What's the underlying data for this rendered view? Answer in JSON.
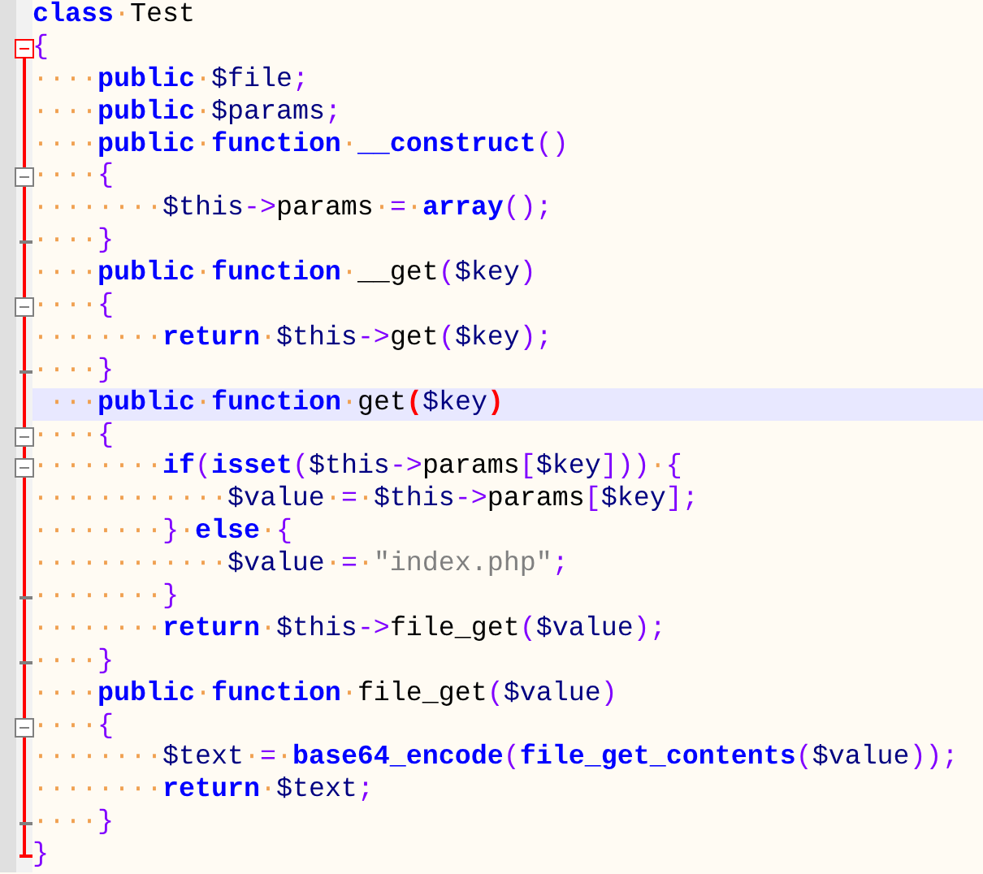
{
  "editor": {
    "lines": [
      {
        "kind": "code",
        "fold_highlighted": false,
        "current": false,
        "tokens": [
          {
            "kind": "keyword",
            "text": "class"
          },
          {
            "kind": "space",
            "text": "·"
          },
          {
            "kind": "plain",
            "text": "Test"
          }
        ]
      },
      {
        "kind": "fold-start",
        "fold_highlighted": true,
        "current": false,
        "tokens": [
          {
            "kind": "operator",
            "text": "{"
          }
        ]
      },
      {
        "kind": "code",
        "fold_highlighted": true,
        "current": false,
        "tokens": [
          {
            "kind": "space",
            "text": "····"
          },
          {
            "kind": "keyword",
            "text": "public"
          },
          {
            "kind": "space",
            "text": "·"
          },
          {
            "kind": "variable",
            "text": "$file"
          },
          {
            "kind": "operator",
            "text": ";"
          }
        ]
      },
      {
        "kind": "code",
        "fold_highlighted": true,
        "current": false,
        "tokens": [
          {
            "kind": "space",
            "text": "····"
          },
          {
            "kind": "keyword",
            "text": "public"
          },
          {
            "kind": "space",
            "text": "·"
          },
          {
            "kind": "variable",
            "text": "$params"
          },
          {
            "kind": "operator",
            "text": ";"
          }
        ]
      },
      {
        "kind": "code",
        "fold_highlighted": true,
        "current": false,
        "tokens": [
          {
            "kind": "space",
            "text": "····"
          },
          {
            "kind": "keyword",
            "text": "public"
          },
          {
            "kind": "space",
            "text": "·"
          },
          {
            "kind": "keyword",
            "text": "function"
          },
          {
            "kind": "space",
            "text": "·"
          },
          {
            "kind": "keyword",
            "text": "__construct"
          },
          {
            "kind": "operator",
            "text": "()"
          }
        ]
      },
      {
        "kind": "fold-start",
        "fold_highlighted": true,
        "current": false,
        "tokens": [
          {
            "kind": "space",
            "text": "····"
          },
          {
            "kind": "operator",
            "text": "{"
          }
        ]
      },
      {
        "kind": "code",
        "fold_highlighted": true,
        "current": false,
        "tokens": [
          {
            "kind": "space",
            "text": "········"
          },
          {
            "kind": "variable",
            "text": "$this"
          },
          {
            "kind": "operator",
            "text": "->"
          },
          {
            "kind": "plain",
            "text": "params"
          },
          {
            "kind": "space",
            "text": "·"
          },
          {
            "kind": "operator",
            "text": "="
          },
          {
            "kind": "space",
            "text": "·"
          },
          {
            "kind": "keyword",
            "text": "array"
          },
          {
            "kind": "operator",
            "text": "();"
          }
        ]
      },
      {
        "kind": "fold-end",
        "fold_highlighted": true,
        "current": false,
        "tokens": [
          {
            "kind": "space",
            "text": "····"
          },
          {
            "kind": "operator",
            "text": "}"
          }
        ]
      },
      {
        "kind": "code",
        "fold_highlighted": true,
        "current": false,
        "tokens": [
          {
            "kind": "space",
            "text": "····"
          },
          {
            "kind": "keyword",
            "text": "public"
          },
          {
            "kind": "space",
            "text": "·"
          },
          {
            "kind": "keyword",
            "text": "function"
          },
          {
            "kind": "space",
            "text": "·"
          },
          {
            "kind": "plain",
            "text": "__get"
          },
          {
            "kind": "operator",
            "text": "("
          },
          {
            "kind": "variable",
            "text": "$key"
          },
          {
            "kind": "operator",
            "text": ")"
          }
        ]
      },
      {
        "kind": "fold-start",
        "fold_highlighted": true,
        "current": false,
        "tokens": [
          {
            "kind": "space",
            "text": "····"
          },
          {
            "kind": "operator",
            "text": "{"
          }
        ]
      },
      {
        "kind": "code",
        "fold_highlighted": true,
        "current": false,
        "tokens": [
          {
            "kind": "space",
            "text": "········"
          },
          {
            "kind": "keyword",
            "text": "return"
          },
          {
            "kind": "space",
            "text": "·"
          },
          {
            "kind": "variable",
            "text": "$this"
          },
          {
            "kind": "operator",
            "text": "->"
          },
          {
            "kind": "plain",
            "text": "get"
          },
          {
            "kind": "operator",
            "text": "("
          },
          {
            "kind": "variable",
            "text": "$key"
          },
          {
            "kind": "operator",
            "text": ");"
          }
        ]
      },
      {
        "kind": "fold-end",
        "fold_highlighted": true,
        "current": false,
        "tokens": [
          {
            "kind": "space",
            "text": "····"
          },
          {
            "kind": "operator",
            "text": "}"
          }
        ]
      },
      {
        "kind": "code",
        "fold_highlighted": true,
        "current": true,
        "tokens": [
          {
            "kind": "space",
            "text": "···"
          },
          {
            "kind": "keyword",
            "text": "public"
          },
          {
            "kind": "space",
            "text": "·"
          },
          {
            "kind": "keyword",
            "text": "function"
          },
          {
            "kind": "space",
            "text": "·"
          },
          {
            "kind": "plain",
            "text": "get"
          },
          {
            "kind": "match",
            "text": "("
          },
          {
            "kind": "variable",
            "text": "$key"
          },
          {
            "kind": "match",
            "text": ")"
          }
        ]
      },
      {
        "kind": "fold-start",
        "fold_highlighted": true,
        "current": false,
        "tokens": [
          {
            "kind": "space",
            "text": "····"
          },
          {
            "kind": "operator",
            "text": "{"
          }
        ]
      },
      {
        "kind": "fold-start",
        "fold_highlighted": true,
        "current": false,
        "tokens": [
          {
            "kind": "space",
            "text": "········"
          },
          {
            "kind": "keyword",
            "text": "if"
          },
          {
            "kind": "operator",
            "text": "("
          },
          {
            "kind": "keyword",
            "text": "isset"
          },
          {
            "kind": "operator",
            "text": "("
          },
          {
            "kind": "variable",
            "text": "$this"
          },
          {
            "kind": "operator",
            "text": "->"
          },
          {
            "kind": "plain",
            "text": "params"
          },
          {
            "kind": "operator",
            "text": "["
          },
          {
            "kind": "variable",
            "text": "$key"
          },
          {
            "kind": "operator",
            "text": "]))"
          },
          {
            "kind": "space",
            "text": "·"
          },
          {
            "kind": "operator",
            "text": "{"
          }
        ]
      },
      {
        "kind": "code",
        "fold_highlighted": true,
        "current": false,
        "tokens": [
          {
            "kind": "space",
            "text": "············"
          },
          {
            "kind": "variable",
            "text": "$value"
          },
          {
            "kind": "space",
            "text": "·"
          },
          {
            "kind": "operator",
            "text": "="
          },
          {
            "kind": "space",
            "text": "·"
          },
          {
            "kind": "variable",
            "text": "$this"
          },
          {
            "kind": "operator",
            "text": "->"
          },
          {
            "kind": "plain",
            "text": "params"
          },
          {
            "kind": "operator",
            "text": "["
          },
          {
            "kind": "variable",
            "text": "$key"
          },
          {
            "kind": "operator",
            "text": "];"
          }
        ]
      },
      {
        "kind": "code",
        "fold_highlighted": true,
        "current": false,
        "tokens": [
          {
            "kind": "space",
            "text": "········"
          },
          {
            "kind": "operator",
            "text": "}"
          },
          {
            "kind": "space",
            "text": "·"
          },
          {
            "kind": "keyword",
            "text": "else"
          },
          {
            "kind": "space",
            "text": "·"
          },
          {
            "kind": "operator",
            "text": "{"
          }
        ]
      },
      {
        "kind": "code",
        "fold_highlighted": true,
        "current": false,
        "tokens": [
          {
            "kind": "space",
            "text": "············"
          },
          {
            "kind": "variable",
            "text": "$value"
          },
          {
            "kind": "space",
            "text": "·"
          },
          {
            "kind": "operator",
            "text": "="
          },
          {
            "kind": "space",
            "text": "·"
          },
          {
            "kind": "string",
            "text": "\"index.php\""
          },
          {
            "kind": "operator",
            "text": ";"
          }
        ]
      },
      {
        "kind": "fold-end",
        "fold_highlighted": true,
        "current": false,
        "tokens": [
          {
            "kind": "space",
            "text": "········"
          },
          {
            "kind": "operator",
            "text": "}"
          }
        ]
      },
      {
        "kind": "code",
        "fold_highlighted": true,
        "current": false,
        "tokens": [
          {
            "kind": "space",
            "text": "········"
          },
          {
            "kind": "keyword",
            "text": "return"
          },
          {
            "kind": "space",
            "text": "·"
          },
          {
            "kind": "variable",
            "text": "$this"
          },
          {
            "kind": "operator",
            "text": "->"
          },
          {
            "kind": "plain",
            "text": "file_get"
          },
          {
            "kind": "operator",
            "text": "("
          },
          {
            "kind": "variable",
            "text": "$value"
          },
          {
            "kind": "operator",
            "text": ");"
          }
        ]
      },
      {
        "kind": "fold-end",
        "fold_highlighted": true,
        "current": false,
        "tokens": [
          {
            "kind": "space",
            "text": "····"
          },
          {
            "kind": "operator",
            "text": "}"
          }
        ]
      },
      {
        "kind": "code",
        "fold_highlighted": true,
        "current": false,
        "tokens": [
          {
            "kind": "space",
            "text": "····"
          },
          {
            "kind": "keyword",
            "text": "public"
          },
          {
            "kind": "space",
            "text": "·"
          },
          {
            "kind": "keyword",
            "text": "function"
          },
          {
            "kind": "space",
            "text": "·"
          },
          {
            "kind": "plain",
            "text": "file_get"
          },
          {
            "kind": "operator",
            "text": "("
          },
          {
            "kind": "variable",
            "text": "$value"
          },
          {
            "kind": "operator",
            "text": ")"
          }
        ]
      },
      {
        "kind": "fold-start",
        "fold_highlighted": true,
        "current": false,
        "tokens": [
          {
            "kind": "space",
            "text": "····"
          },
          {
            "kind": "operator",
            "text": "{"
          }
        ]
      },
      {
        "kind": "code",
        "fold_highlighted": true,
        "current": false,
        "tokens": [
          {
            "kind": "space",
            "text": "········"
          },
          {
            "kind": "variable",
            "text": "$text"
          },
          {
            "kind": "space",
            "text": "·"
          },
          {
            "kind": "operator",
            "text": "="
          },
          {
            "kind": "space",
            "text": "·"
          },
          {
            "kind": "keyword",
            "text": "base64_encode"
          },
          {
            "kind": "operator",
            "text": "("
          },
          {
            "kind": "keyword",
            "text": "file_get_contents"
          },
          {
            "kind": "operator",
            "text": "("
          },
          {
            "kind": "variable",
            "text": "$value"
          },
          {
            "kind": "operator",
            "text": "));"
          }
        ]
      },
      {
        "kind": "code",
        "fold_highlighted": true,
        "current": false,
        "tokens": [
          {
            "kind": "space",
            "text": "········"
          },
          {
            "kind": "keyword",
            "text": "return"
          },
          {
            "kind": "space",
            "text": "·"
          },
          {
            "kind": "variable",
            "text": "$text"
          },
          {
            "kind": "operator",
            "text": ";"
          }
        ]
      },
      {
        "kind": "fold-end",
        "fold_highlighted": true,
        "current": false,
        "tokens": [
          {
            "kind": "space",
            "text": "····"
          },
          {
            "kind": "operator",
            "text": "}"
          }
        ]
      },
      {
        "kind": "fold-end",
        "fold_highlighted": true,
        "current": false,
        "tokens": [
          {
            "kind": "operator",
            "text": "}"
          }
        ]
      }
    ]
  }
}
